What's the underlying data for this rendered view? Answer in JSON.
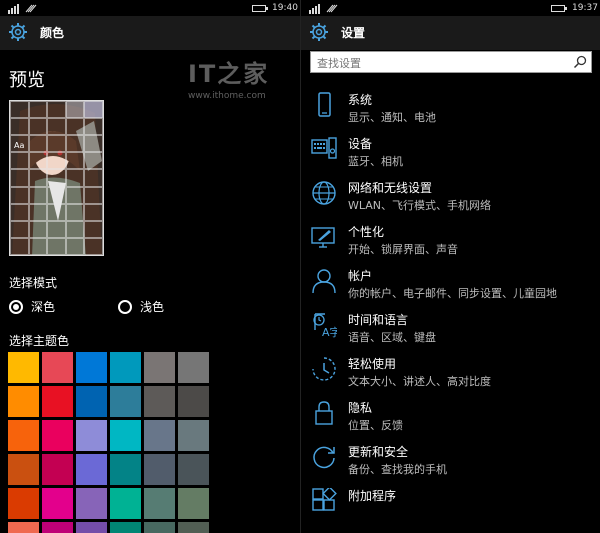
{
  "colors": {
    "accent": "#4aa3df"
  },
  "left": {
    "status": {
      "time": "19:40"
    },
    "header": {
      "title": "颜色"
    },
    "preview_label": "预览",
    "preview_aa": "Aa",
    "mode": {
      "label": "选择模式",
      "options": [
        {
          "label": "深色",
          "selected": true
        },
        {
          "label": "浅色",
          "selected": false
        }
      ]
    },
    "theme": {
      "label": "选择主题色",
      "swatches": [
        "#ffb900",
        "#e74856",
        "#0078d7",
        "#0099bc",
        "#7a7574",
        "#767676",
        "#ff8c00",
        "#e81123",
        "#0063b1",
        "#2d7d9a",
        "#5d5a58",
        "#4c4a48",
        "#f7630c",
        "#ea005e",
        "#8e8cd8",
        "#00b7c3",
        "#68768a",
        "#69797e",
        "#ca5010",
        "#c30052",
        "#6b69d6",
        "#038387",
        "#515c6b",
        "#4a5459",
        "#da3b01",
        "#e3008c",
        "#8764b8",
        "#00b294",
        "#567c73",
        "#647c64",
        "#ef6950",
        "#bf0077",
        "#744da9",
        "#018574",
        "#486860",
        "#525e54"
      ]
    }
  },
  "watermark": {
    "logo": "IT之家",
    "url": "www.ithome.com"
  },
  "right": {
    "status": {
      "time": "19:37"
    },
    "header": {
      "title": "设置"
    },
    "search": {
      "placeholder": "查找设置"
    },
    "items": [
      {
        "icon": "phone-icon",
        "name": "系统",
        "desc": "显示、通知、电池"
      },
      {
        "icon": "devices-icon",
        "name": "设备",
        "desc": "蓝牙、相机"
      },
      {
        "icon": "globe-icon",
        "name": "网络和无线设置",
        "desc": "WLAN、飞行模式、手机网络"
      },
      {
        "icon": "personalization-icon",
        "name": "个性化",
        "desc": "开始、锁屏界面、声音"
      },
      {
        "icon": "person-icon",
        "name": "帐户",
        "desc": "你的帐户、电子邮件、同步设置、儿童园地"
      },
      {
        "icon": "time-language-icon",
        "name": "时间和语言",
        "desc": "语音、区域、键盘"
      },
      {
        "icon": "ease-of-access-icon",
        "name": "轻松使用",
        "desc": "文本大小、讲述人、高对比度"
      },
      {
        "icon": "lock-icon",
        "name": "隐私",
        "desc": "位置、反馈"
      },
      {
        "icon": "update-icon",
        "name": "更新和安全",
        "desc": "备份、查找我的手机"
      },
      {
        "icon": "extras-icon",
        "name": "附加程序",
        "desc": ""
      }
    ]
  }
}
